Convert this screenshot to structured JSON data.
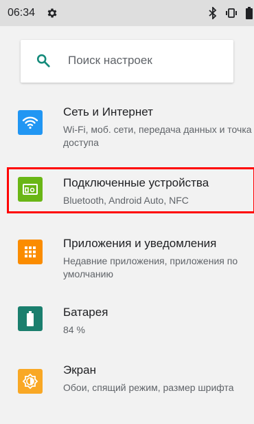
{
  "status_bar": {
    "time": "06:34",
    "left_icons": [
      "gear-icon"
    ],
    "right_icons": [
      "bluetooth-icon",
      "vibrate-icon",
      "battery-icon"
    ]
  },
  "search": {
    "placeholder": "Поиск настроек",
    "icon": "search-icon"
  },
  "settings": [
    {
      "title": "Сеть и Интернет",
      "subtitle": "Wi-Fi, моб. сети, передача данных и точка доступа",
      "icon": "wifi-icon",
      "color": "#2196f3"
    },
    {
      "title": "Подключенные устройства",
      "subtitle": "Bluetooth, Android Auto, NFC",
      "icon": "connected-devices-icon",
      "color": "#6ab616",
      "highlighted": true
    },
    {
      "title": "Приложения и уведомления",
      "subtitle": "Недавние приложения, приложения по умолчанию",
      "icon": "apps-icon",
      "color": "#fb8c00"
    },
    {
      "title": "Батарея",
      "subtitle": "84 %",
      "icon": "battery-icon",
      "color": "#1b7f6e"
    },
    {
      "title": "Экран",
      "subtitle": "Обои, спящий режим, размер шрифта",
      "icon": "brightness-icon",
      "color": "#f9a825"
    }
  ],
  "colors": {
    "background": "#f2f2f2",
    "status_bar": "#dedede",
    "search_icon": "#138a7a",
    "highlight": "#ff0000"
  }
}
